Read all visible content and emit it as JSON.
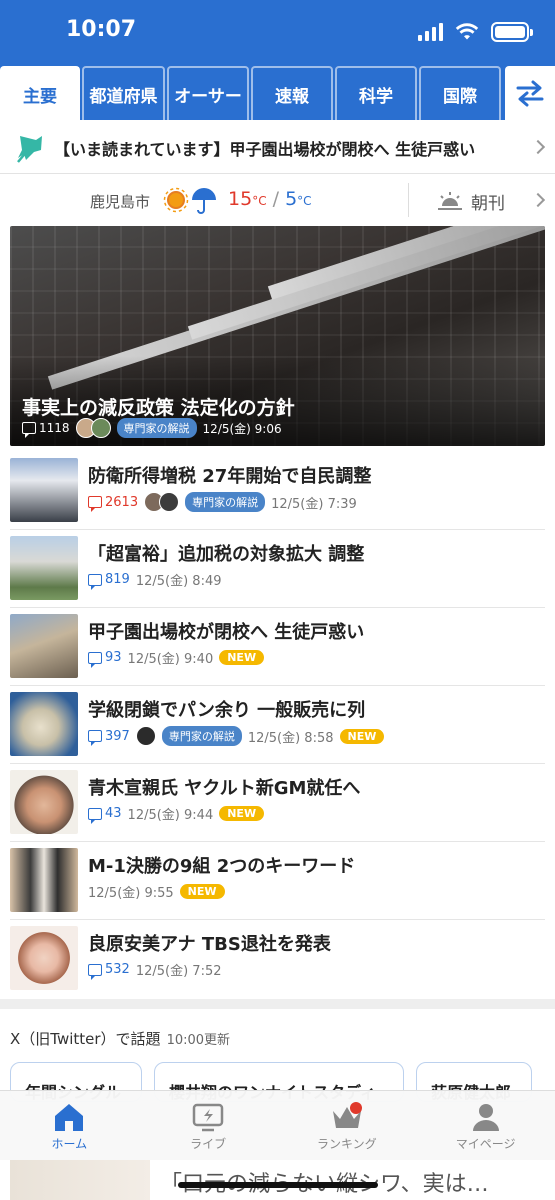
{
  "status": {
    "time": "10:07"
  },
  "tabs": [
    {
      "label": "主要"
    },
    {
      "label": "都道府県"
    },
    {
      "label": "オーサー"
    },
    {
      "label": "速報"
    },
    {
      "label": "科学"
    },
    {
      "label": "国際"
    }
  ],
  "pickup": {
    "text": "【いま読まれています】甲子園出場校が閉校へ 生徒戸惑い"
  },
  "weather": {
    "city": "鹿児島市",
    "high": "15",
    "low": "5",
    "unit": "°C",
    "sep": "/",
    "chokan": "朝刊"
  },
  "hero": {
    "title": "事実上の減反政策 法定化の方針",
    "comments": "1118",
    "badge": "専門家の解説",
    "date": "12/5(金) 9:06"
  },
  "articles": [
    {
      "title": "防衛所得増税 27年開始で自民調整",
      "comments": "2613",
      "badge": "専門家の解説",
      "date": "12/5(金) 7:39",
      "new": ""
    },
    {
      "title": "「超富裕」追加税の対象拡大 調整",
      "comments": "819",
      "badge": "",
      "date": "12/5(金) 8:49",
      "new": ""
    },
    {
      "title": "甲子園出場校が閉校へ 生徒戸惑い",
      "comments": "93",
      "badge": "",
      "date": "12/5(金) 9:40",
      "new": "NEW"
    },
    {
      "title": "学級閉鎖でパン余り 一般販売に列",
      "comments": "397",
      "badge": "専門家の解説",
      "date": "12/5(金) 8:58",
      "new": "NEW"
    },
    {
      "title": "青木宣親氏 ヤクルト新GM就任へ",
      "comments": "43",
      "badge": "",
      "date": "12/5(金) 9:44",
      "new": "NEW"
    },
    {
      "title": "M-1決勝の9組 2つのキーワード",
      "comments": "",
      "badge": "",
      "date": "12/5(金) 9:55",
      "new": "NEW"
    },
    {
      "title": "良原安美アナ TBS退社を発表",
      "comments": "532",
      "badge": "",
      "date": "12/5(金) 7:52",
      "new": ""
    }
  ],
  "x_section": {
    "title": "X（旧Twitter）で話題",
    "updated": "10:00更新",
    "chips": [
      "年間シングル",
      "櫻井翔のワンナイトスタディ",
      "荻原健太郎"
    ]
  },
  "bottom_nav": [
    {
      "label": "ホーム"
    },
    {
      "label": "ライブ"
    },
    {
      "label": "ランキング"
    },
    {
      "label": "マイページ"
    }
  ],
  "peek": {
    "text": "「口元の減らない縦シワ、実は…"
  },
  "colors": {
    "brand": "#2a6fd0",
    "alert": "#e0392b",
    "new": "#f5b800",
    "badge": "#4a84c8"
  }
}
